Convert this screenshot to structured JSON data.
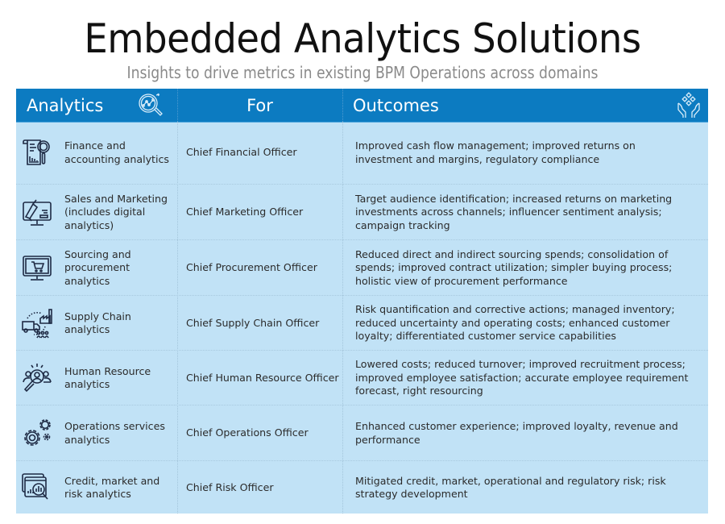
{
  "header": {
    "title": "Embedded Analytics Solutions",
    "subtitle": "Insights to drive metrics in existing BPM Operations across domains"
  },
  "colors": {
    "header_bg": "#0c7bc1",
    "table_bg": "#c1e2f6",
    "title_text": "#111111",
    "subtitle_text": "#8a8a8a",
    "icon_stroke": "#1e2a44"
  },
  "table": {
    "columns": [
      {
        "label": "Analytics",
        "icon": "analytics-magnifier-icon"
      },
      {
        "label": "For"
      },
      {
        "label": "Outcomes",
        "icon": "hands-giving-icon"
      }
    ],
    "rows": [
      {
        "icon": "finance-report-icon",
        "name": "Finance and accounting analytics",
        "for": "Chief Financial Officer",
        "outcomes": "Improved cash flow management; improved returns on investment and margins, regulatory compliance"
      },
      {
        "icon": "megaphone-monitor-icon",
        "name": "Sales and Marketing (includes digital analytics)",
        "for": "Chief Marketing Officer",
        "outcomes": "Target audience identification; increased returns on marketing investments across channels; influencer sentiment analysis; campaign tracking"
      },
      {
        "icon": "cart-monitor-icon",
        "name": "Sourcing and procurement analytics",
        "for": "Chief Procurement Officer",
        "outcomes": "Reduced direct and indirect sourcing spends; consolidation of spends; improved contract utilization; simpler buying process; holistic view of procurement performance"
      },
      {
        "icon": "supply-chain-icon",
        "name": "Supply Chain analytics",
        "for": "Chief Supply Chain Officer",
        "outcomes": "Risk quantification and corrective actions; managed inventory; reduced uncertainty and operating costs; enhanced customer loyalty; differentiated customer service capabilities"
      },
      {
        "icon": "people-search-icon",
        "name": "Human Resource analytics",
        "for": "Chief Human Resource Officer",
        "outcomes": "Lowered costs; reduced turnover; improved recruitment process; improved employee satisfaction; accurate employee requirement forecast, right resourcing"
      },
      {
        "icon": "gears-icon",
        "name": "Operations services analytics",
        "for": "Chief Operations Officer",
        "outcomes": "Enhanced customer experience; improved loyalty, revenue and performance"
      },
      {
        "icon": "risk-chart-search-icon",
        "name": "Credit, market and risk analytics",
        "for": "Chief Risk Officer",
        "outcomes": "Mitigated credit, market, operational and regulatory risk; risk strategy development"
      }
    ]
  }
}
